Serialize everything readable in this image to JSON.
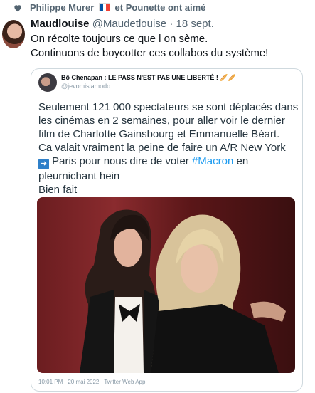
{
  "social_context": {
    "text_before_flag": "Philippe Murer",
    "text_after_flag": "et Pounette ont aimé"
  },
  "tweet": {
    "author_name": "Maudlouise",
    "author_handle": "@Maudetlouise",
    "separator": "·",
    "date": "18 sept.",
    "lines": [
      "On récolte toujours ce que l on sème.",
      "Continuons de boycotter ces collabos du système!"
    ]
  },
  "quoted": {
    "name": "Bô Chenapan : LE PASS N'EST PAS UNE LIBERTÉ !",
    "handle": "@jevomislamodo",
    "lines": [
      "Seulement 121 000 spectateurs se sont déplacés dans",
      "les cinémas en 2 semaines, pour aller voir le dernier",
      "film de Charlotte Gainsbourg et Emmanuelle Béart.",
      "Ca valait vraiment la peine de faire un A/R New York"
    ],
    "line5_after_arrow": "Paris pour nous dire de voter",
    "hashtag": "#Macron",
    "line5_end": "en",
    "line6": "pleurnichant hein",
    "line7": "Bien fait",
    "footer": "10:01 PM · 20 mai 2022 · Twitter Web App"
  },
  "colors": {
    "accent": "#1d9bf0",
    "muted": "#536471"
  }
}
